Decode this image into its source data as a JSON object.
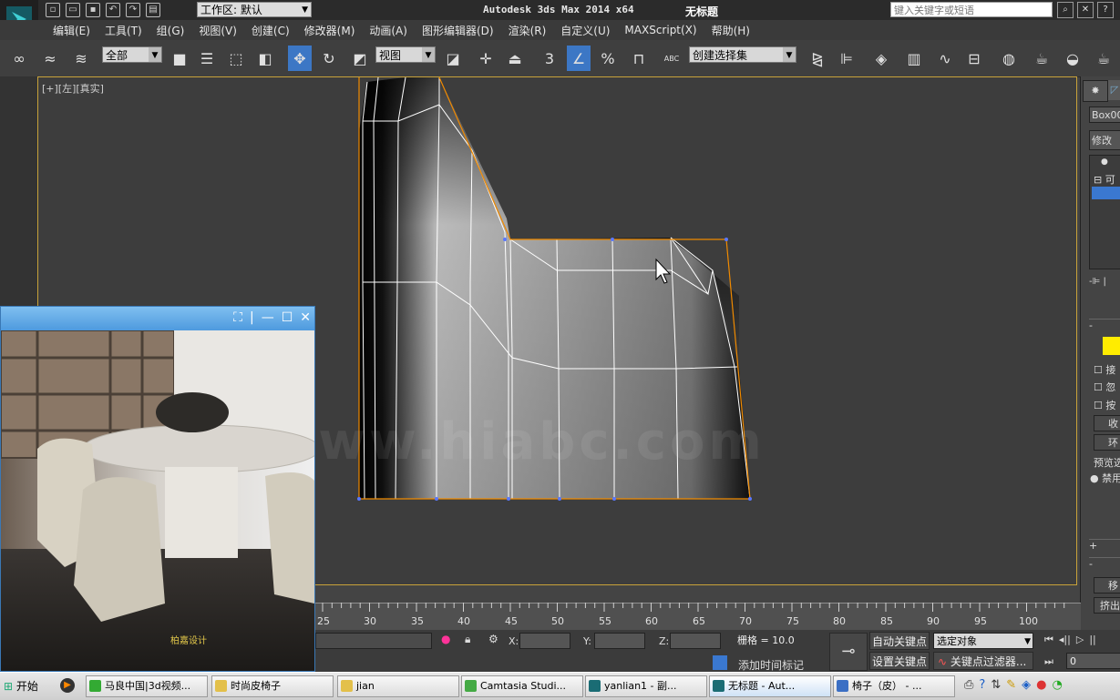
{
  "titlebar": {
    "workspace_label": "工作区: 默认",
    "app_title": "Autodesk 3ds Max  2014 x64",
    "document_title": "无标题",
    "search_placeholder": "键入关键字或短语"
  },
  "menubar": {
    "items": [
      "编辑(E)",
      "工具(T)",
      "组(G)",
      "视图(V)",
      "创建(C)",
      "修改器(M)",
      "动画(A)",
      "图形编辑器(D)",
      "渲染(R)",
      "自定义(U)",
      "MAXScript(X)",
      "帮助(H)"
    ]
  },
  "toolbar": {
    "selection_filter": "全部",
    "reference_coord": "视图",
    "named_selection": "创建选择集",
    "snap_number": "3",
    "angle_snap_label": "%",
    "abc_label": "ABC"
  },
  "viewport": {
    "label": "[+][左][真实]",
    "watermark": "中国 www.hiabc.com"
  },
  "right_panel": {
    "object_name": "Box00",
    "modifier_list": "修改器",
    "stack_item": "可",
    "check_items": [
      "接",
      "忽",
      "按"
    ],
    "btn_1": "收",
    "btn_2": "环",
    "preview_label": "预览选",
    "radio_label": "禁用",
    "bottom_btn_1": "移",
    "bottom_btn_2": "挤出"
  },
  "video_window": {
    "caption": "柏嘉设计"
  },
  "timeline": {
    "ticks": [
      "25",
      "30",
      "35",
      "40",
      "45",
      "50",
      "55",
      "60",
      "65",
      "70",
      "75",
      "80",
      "85",
      "90",
      "95",
      "100"
    ]
  },
  "status": {
    "x_label": "X:",
    "y_label": "Y:",
    "z_label": "Z:",
    "grid_label": "栅格 = 10.0",
    "add_time_tag": "添加时间标记",
    "auto_key": "自动关键点",
    "set_key": "设置关键点",
    "selected_object": "选定对象",
    "key_filters": "关键点过滤器...",
    "frame_value": "0"
  },
  "taskbar": {
    "start": "开始",
    "tasks": [
      "马良中国|3d视频...",
      "时尚皮椅子",
      "jian",
      "Camtasia Studi...",
      "yanlian1 - 副...",
      "无标题 - Aut...",
      "椅子（皮） - ..."
    ]
  },
  "colors": {
    "selection_orange": "#f08a00",
    "toolbar_active": "#3c77c5",
    "viewport_border": "#c8a23a"
  }
}
